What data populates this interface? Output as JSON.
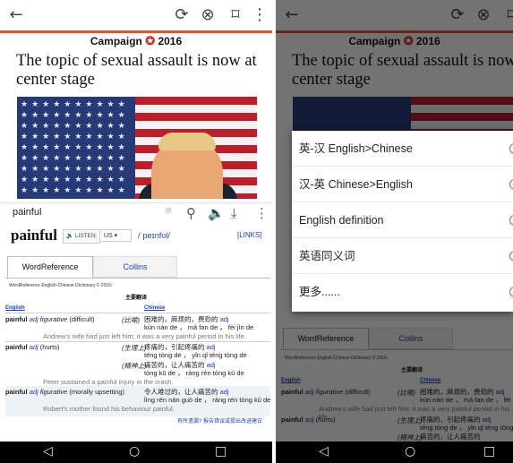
{
  "article": {
    "brand_left": "Campaign",
    "brand_right": "2016",
    "headline": "The topic of sexual assault is now at center stage"
  },
  "toolbar": {
    "back": "←",
    "refresh": "⟳",
    "close": "⊗",
    "bookmark": "⌑",
    "more": "⋮"
  },
  "lookup": {
    "query": "painful",
    "headword": "painful",
    "listen_label": "LISTEN:",
    "accent": "US",
    "phonetic": "/ˈpeɪnfʊl/",
    "links_label": "[LINKS]",
    "tabs": [
      "WordReference",
      "Collins"
    ],
    "dict_title": "WordReference English-Chinese Dictionary © 2016:",
    "section_heading": "主要翻译",
    "col_english": "English",
    "col_chinese": "Chinese",
    "entries": [
      {
        "word": "painful",
        "pos": "adj",
        "sense": "figurative",
        "gloss": "(difficult)",
        "context": "(比喻)",
        "zh": "困难的，麻烦的，费劲的",
        "zh_pos": "adj",
        "pinyin": "kùn nán de ， má fan de ， fèi jìn de",
        "example": "Andrew's wife had just left him; it was a very painful period in his life."
      },
      {
        "word": "painful",
        "pos": "adj",
        "sense": "",
        "gloss": "(hurts)",
        "context": "(生理上)",
        "zh": "疼痛的，引起疼痛的",
        "zh_pos": "adj",
        "pinyin": "téng tòng de ， yǐn qǐ téng tòng de",
        "context2": "(精神上)",
        "zh2": "痛苦的，让人痛苦的",
        "zh2_pos": "adj",
        "pinyin2": "tòng kǔ de ， ràng rén tòng kǔ de",
        "example": "Peter sustained a painful injury in the crash."
      },
      {
        "word": "painful",
        "pos": "adj",
        "sense": "figurative",
        "gloss": "(morally upsetting)",
        "context": "",
        "zh": "令人难过的，让人痛苦的",
        "zh_pos": "adj",
        "pinyin": "lìng rén nán guò de ， ràng rén tòng kǔ de",
        "example": "Robert's mother found his behaviour painful."
      }
    ],
    "report_link": "有所遗漏? 报告错误或提出改进建议"
  },
  "menu": {
    "items": [
      "英-汉 English>Chinese",
      "汉-英 Chinese>English",
      "English definition",
      "英语同义词",
      "更多......"
    ]
  },
  "navbar": {
    "back": "◁",
    "home": "○",
    "recents": "□"
  },
  "colors": {
    "accent": "#e4552f",
    "link": "#1f3fb0"
  }
}
